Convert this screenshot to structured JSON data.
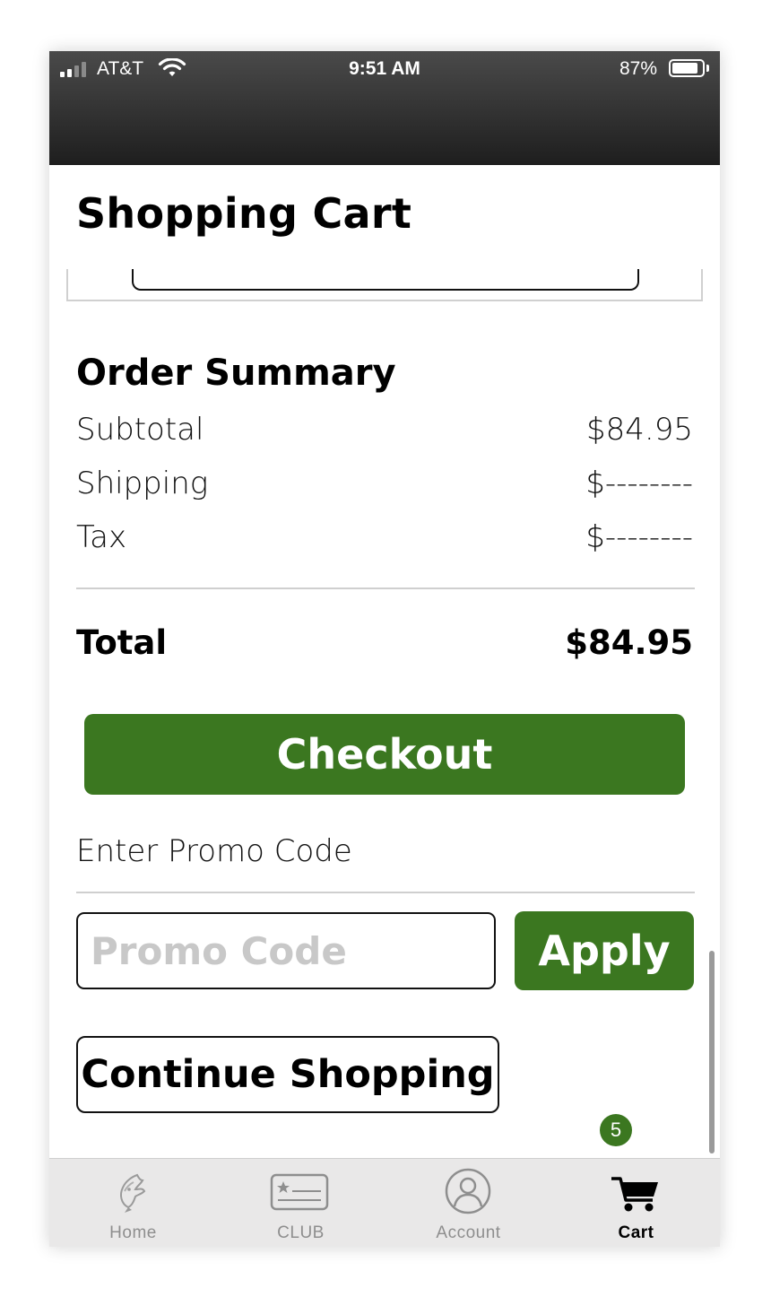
{
  "status_bar": {
    "carrier": "AT&T",
    "time": "9:51 AM",
    "battery": "87%"
  },
  "page": {
    "title": "Shopping Cart"
  },
  "order_summary": {
    "title": "Order Summary",
    "rows": [
      {
        "label": "Subtotal",
        "value": "$84.95"
      },
      {
        "label": "Shipping",
        "value": "$--------"
      },
      {
        "label": "Tax",
        "value": "$--------"
      }
    ],
    "total_label": "Total",
    "total_value": "$84.95"
  },
  "actions": {
    "checkout_label": "Checkout",
    "promo_label": "Enter Promo Code",
    "promo_placeholder": "Promo Code",
    "promo_value": "",
    "apply_label": "Apply",
    "continue_label": "Continue Shopping"
  },
  "tab_bar": {
    "items": [
      {
        "label": "Home",
        "icon": "bass-fish-icon"
      },
      {
        "label": "CLUB",
        "icon": "club-card-icon"
      },
      {
        "label": "Account",
        "icon": "account-icon"
      },
      {
        "label": "Cart",
        "icon": "cart-icon"
      }
    ],
    "active": "Cart",
    "cart_badge": "5"
  },
  "colors": {
    "accent_green": "#3b7720",
    "header_dark": "#1e1e1e",
    "tabbar_bg": "#e9e8e8"
  }
}
